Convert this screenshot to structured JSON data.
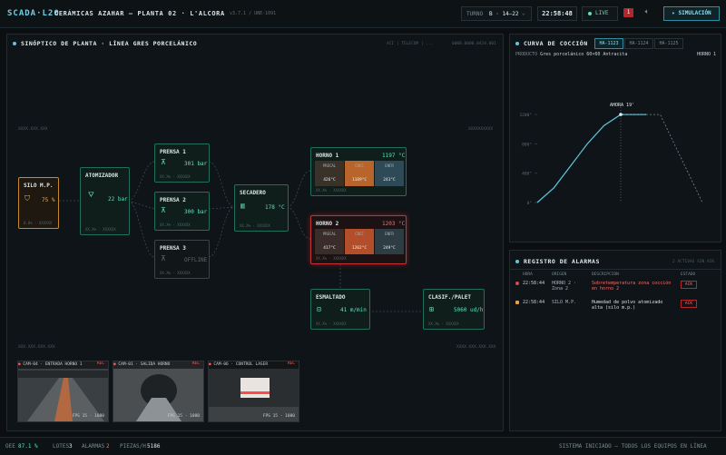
{
  "app": {
    "logo": "SCADA·L20",
    "plant": "CERÁMICAS AZAHAR — PLANTA 02 · L'ALCORA",
    "version": "v3.7.1 / UNE-1091"
  },
  "topbar": {
    "turno_label": "TURNO",
    "turno_value": "B · 14–22",
    "clock": "22:58:48",
    "live_label": "LIVE",
    "alarm_count": "1",
    "sim_button": "SIMULACIÓN"
  },
  "synoptic": {
    "title": "SINÓPTICO DE PLANTA · LÍNEA GRES PORCELÁNICO",
    "tag_left": "ACI | TELECOM | ...",
    "tag_right": "0000.0000.0424.001",
    "corner_tl": "XXXX.XXX.XXX",
    "corner_tr": "XXXXXXXXXX",
    "corner_bl": "XXX.XXX.XXX.XXX",
    "corner_br": "XXXX.XXX.XXX.XXX",
    "nodes": {
      "silo": {
        "title": "SILO M.P.",
        "value": "75 %",
        "sub": "0.0% · XXXXXX"
      },
      "atomizador": {
        "title": "ATOMIZADOR",
        "value": "22 bar",
        "sub": "XX.X% · XXXXXX"
      },
      "prensa1": {
        "title": "PRENSA 1",
        "value": "301 bar",
        "sub": "XX.X% · XXXXXX"
      },
      "prensa2": {
        "title": "PRENSA 2",
        "value": "300 bar",
        "sub": "XX.X% · XXXXXX"
      },
      "prensa3": {
        "title": "PRENSA 3",
        "value": "OFFLINE",
        "sub": "XX.X% · XXXXXX"
      },
      "secadero": {
        "title": "SECADERO",
        "value": "178 °C",
        "sub": "XX.X% · XXXXXX"
      },
      "horno1": {
        "title": "HORNO 1",
        "value": "1197 °C",
        "sub": "XX.X% · XXXXXX",
        "zones": [
          {
            "label": "PRECAL",
            "value": "426°C"
          },
          {
            "label": "COCC",
            "value": "1189°C"
          },
          {
            "label": "ENFR",
            "value": "243°C"
          }
        ]
      },
      "horno2": {
        "title": "HORNO 2",
        "value": "1203 °C",
        "sub": "XX.X% · XXXXXX",
        "zones": [
          {
            "label": "PRECAL",
            "value": "417°C"
          },
          {
            "label": "COCC",
            "value": "1202°C"
          },
          {
            "label": "ENFR",
            "value": "249°C"
          }
        ]
      },
      "esmaltado": {
        "title": "ESMALTADO",
        "value": "41 m/min",
        "sub": "XX.X% · XXXXXX"
      },
      "clasif": {
        "title": "CLASIF./PALET",
        "value": "5060 ud/h",
        "sub": "XX.X% · XXXXXX"
      }
    },
    "cams": [
      {
        "id": "CAM-04",
        "label": "ENTRADA HORNO 1",
        "rec": "REC",
        "fps": "FPS 15 · 1080"
      },
      {
        "id": "CAM-01",
        "label": "SALIDA HORNO",
        "rec": "REC",
        "fps": "FPS 15 · 1080"
      },
      {
        "id": "CAM-06",
        "label": "CONTROL LASER",
        "rec": "REC",
        "fps": "FPS 15 · 1080"
      }
    ]
  },
  "curve": {
    "title": "CURVA DE COCCIÓN",
    "tabs": [
      "HA-1123",
      "HA-1124",
      "HA-1125"
    ],
    "product_label": "PRODUCTO",
    "product_value": "Gres porcelánico 60×60 Antracita",
    "oven_label": "HORNO 1",
    "now_label": "AHORA 19'",
    "chart_data": {
      "type": "line",
      "ylim": [
        0,
        1300
      ],
      "yticks": [
        "1200°",
        "800°",
        "400°",
        "0°"
      ],
      "series": [
        {
          "values": [
            0,
            200,
            500,
            800,
            1050,
            1200,
            1200,
            1200
          ]
        },
        {
          "values": [
            1200,
            1200,
            800,
            400,
            0
          ]
        }
      ]
    }
  },
  "alarms": {
    "title": "REGISTRO DE ALARMAS",
    "count": "2 ACTIVAS SIN ACK",
    "headers": [
      "HORA",
      "ORIGEN",
      "DESCRIPCIÓN",
      "ESTADO"
    ],
    "rows": [
      {
        "time": "22:58:44",
        "origin": "HORNO 2 · Zona 2",
        "desc": "Sobretemperatura zona cocción en horno 2",
        "state": "ACK",
        "color": "#e0444a"
      },
      {
        "time": "22:58:44",
        "origin": "SILO M.P.",
        "desc": "Humedad de polvo atomizado alta (silo m.p.)",
        "state": "ACK",
        "color": "#e8a13a"
      }
    ]
  },
  "statusbar": {
    "oee_label": "OEE",
    "oee_value": "87.1 %",
    "lotes_label": "LOTES",
    "lotes_value": "3",
    "alarmas_label": "ALARMAS",
    "alarmas_value": "2",
    "piezas_label": "PIEZAS/H",
    "piezas_value": "5186",
    "message": "SISTEMA INICIADO — TODOS LOS EQUIPOS EN LÍNEA"
  }
}
